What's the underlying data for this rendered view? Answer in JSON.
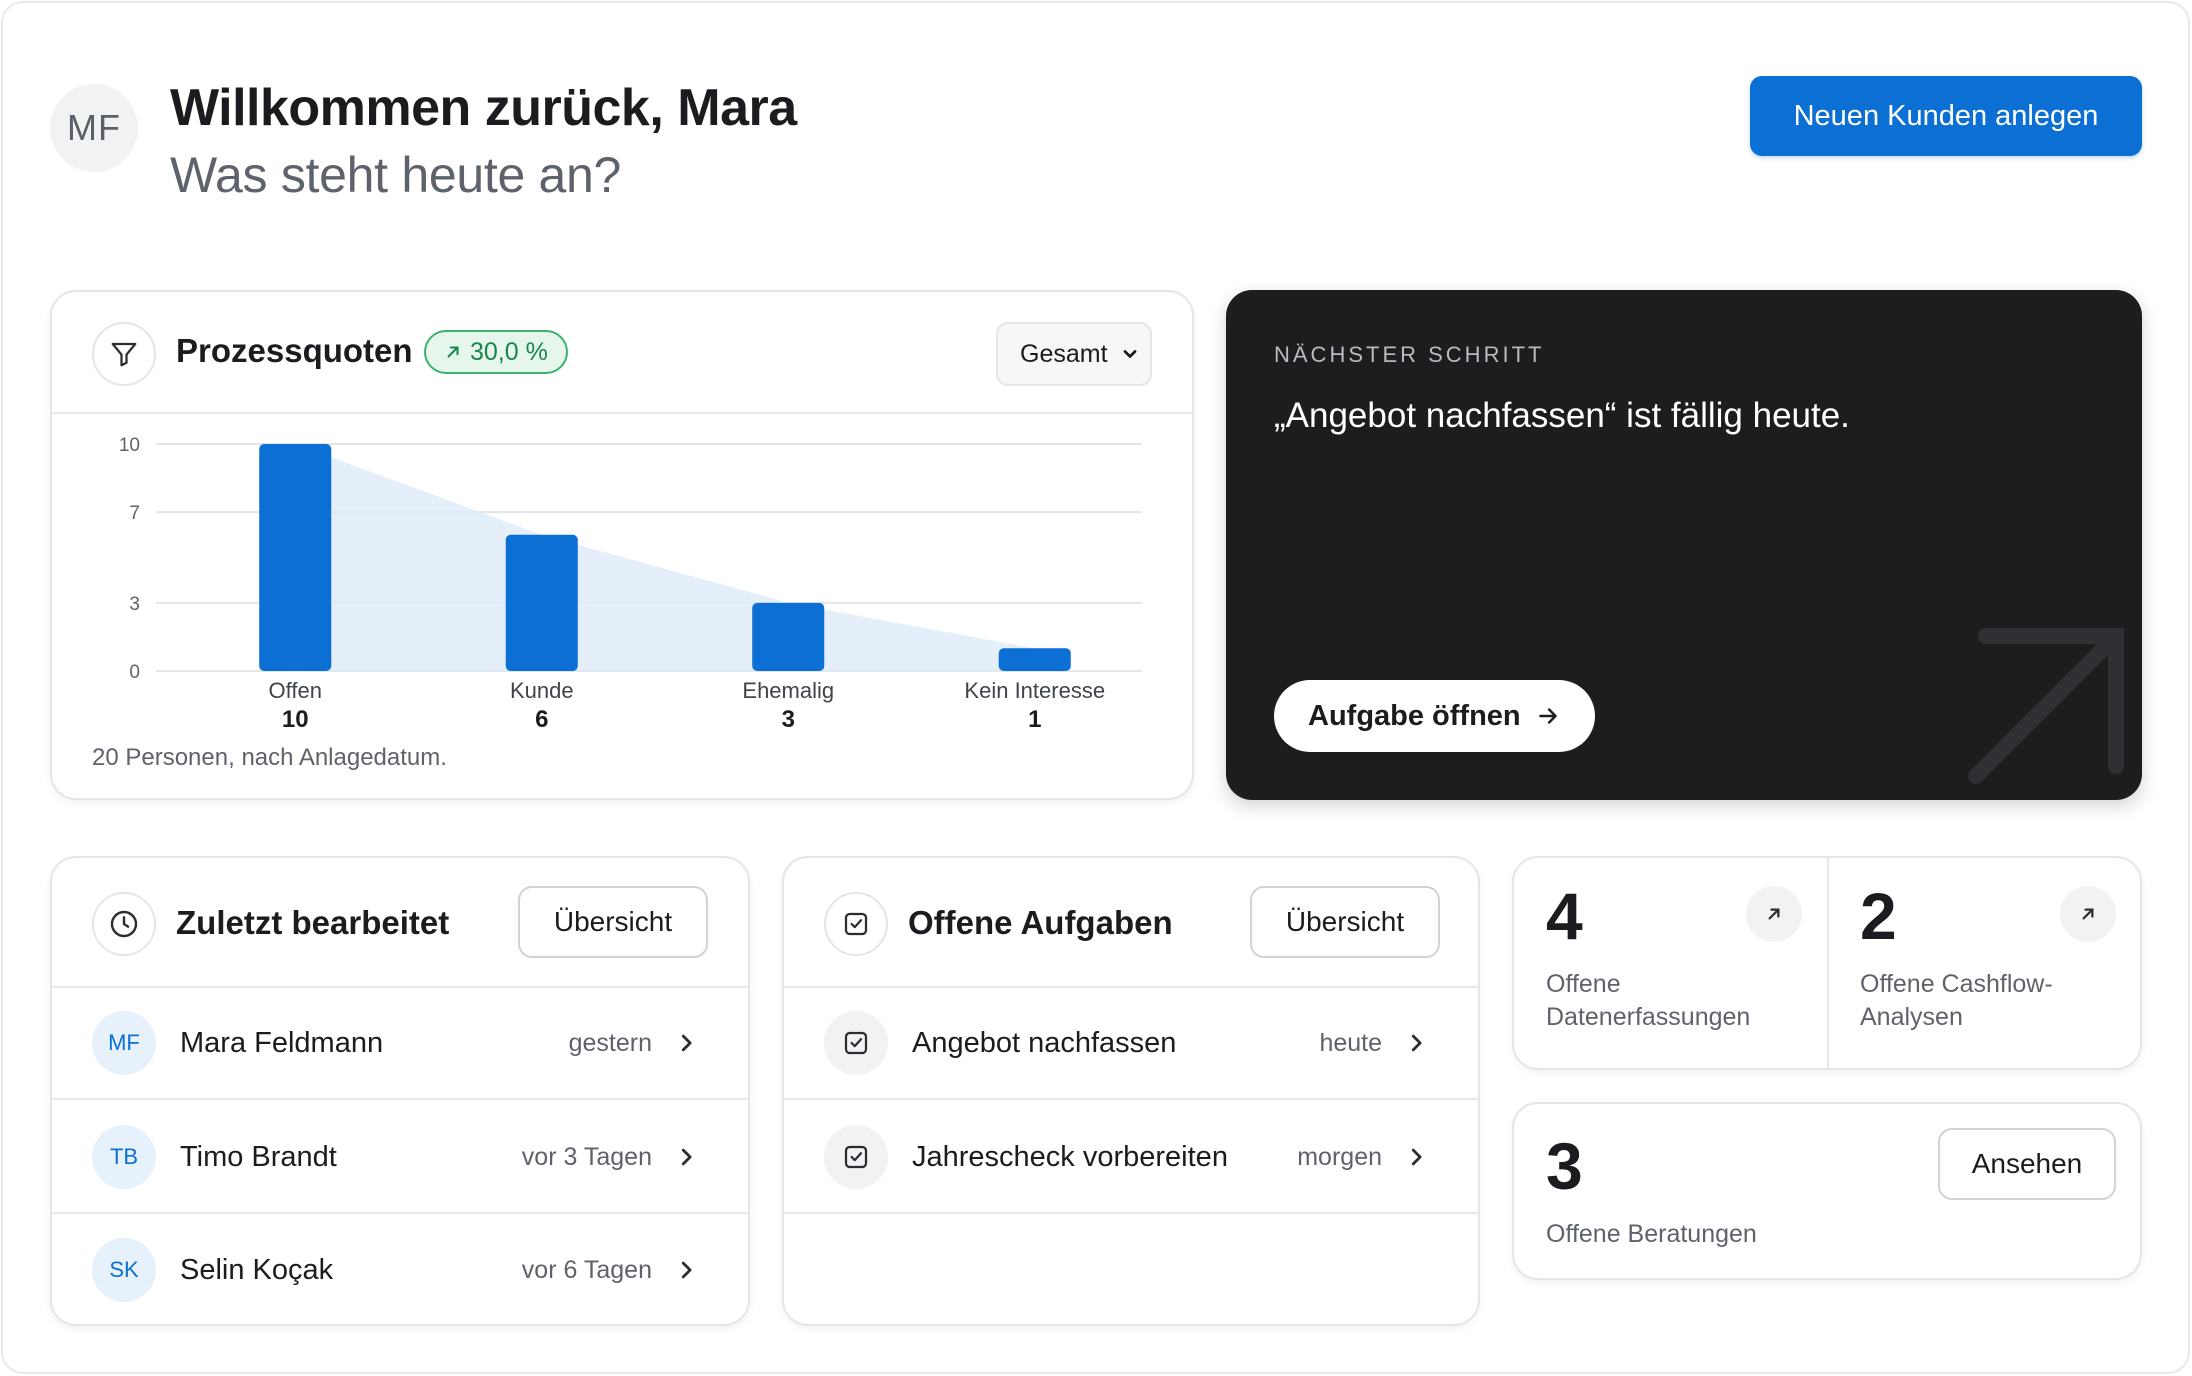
{
  "header": {
    "avatar_initials": "MF",
    "title": "Willkommen zurück, Mara",
    "subtitle": "Was steht heute an?",
    "primary_button": "Neuen Kunden anlegen"
  },
  "process_card": {
    "title": "Prozessquoten",
    "badge": "30,0 %",
    "select_value": "Gesamt",
    "caption": "20 Personen, nach Anlagedatum."
  },
  "chart_data": {
    "type": "bar",
    "categories": [
      "Offen",
      "Kunde",
      "Ehemalig",
      "Kein Interesse"
    ],
    "values": [
      10,
      6,
      3,
      1
    ],
    "ylim": [
      0,
      10
    ],
    "yticks": [
      0,
      3,
      7,
      10
    ],
    "grid": true,
    "accent": "#0b6fd4"
  },
  "next_step": {
    "label": "NÄCHSTER SCHRITT",
    "text": "„Angebot nachfassen“ ist fällig heute.",
    "button": "Aufgabe öffnen"
  },
  "recent": {
    "title": "Zuletzt bearbeitet",
    "button": "Übersicht",
    "items": [
      {
        "initials": "MF",
        "name": "Mara Feldmann",
        "when": "gestern"
      },
      {
        "initials": "TB",
        "name": "Timo Brandt",
        "when": "vor 3 Tagen"
      },
      {
        "initials": "SK",
        "name": "Selin Koçak",
        "when": "vor 6 Tagen"
      }
    ]
  },
  "tasks": {
    "title": "Offene Aufgaben",
    "button": "Übersicht",
    "items": [
      {
        "name": "Angebot nachfassen",
        "when": "heute"
      },
      {
        "name": "Jahrescheck vorbereiten",
        "when": "morgen"
      }
    ]
  },
  "stats": {
    "data_entries": {
      "count": "4",
      "label": "Offene Datenerfassungen"
    },
    "cashflow": {
      "count": "2",
      "label": "Offene Cashflow-Analysen"
    },
    "consultations": {
      "count": "3",
      "label": "Offene Beratungen",
      "button": "Ansehen"
    }
  }
}
